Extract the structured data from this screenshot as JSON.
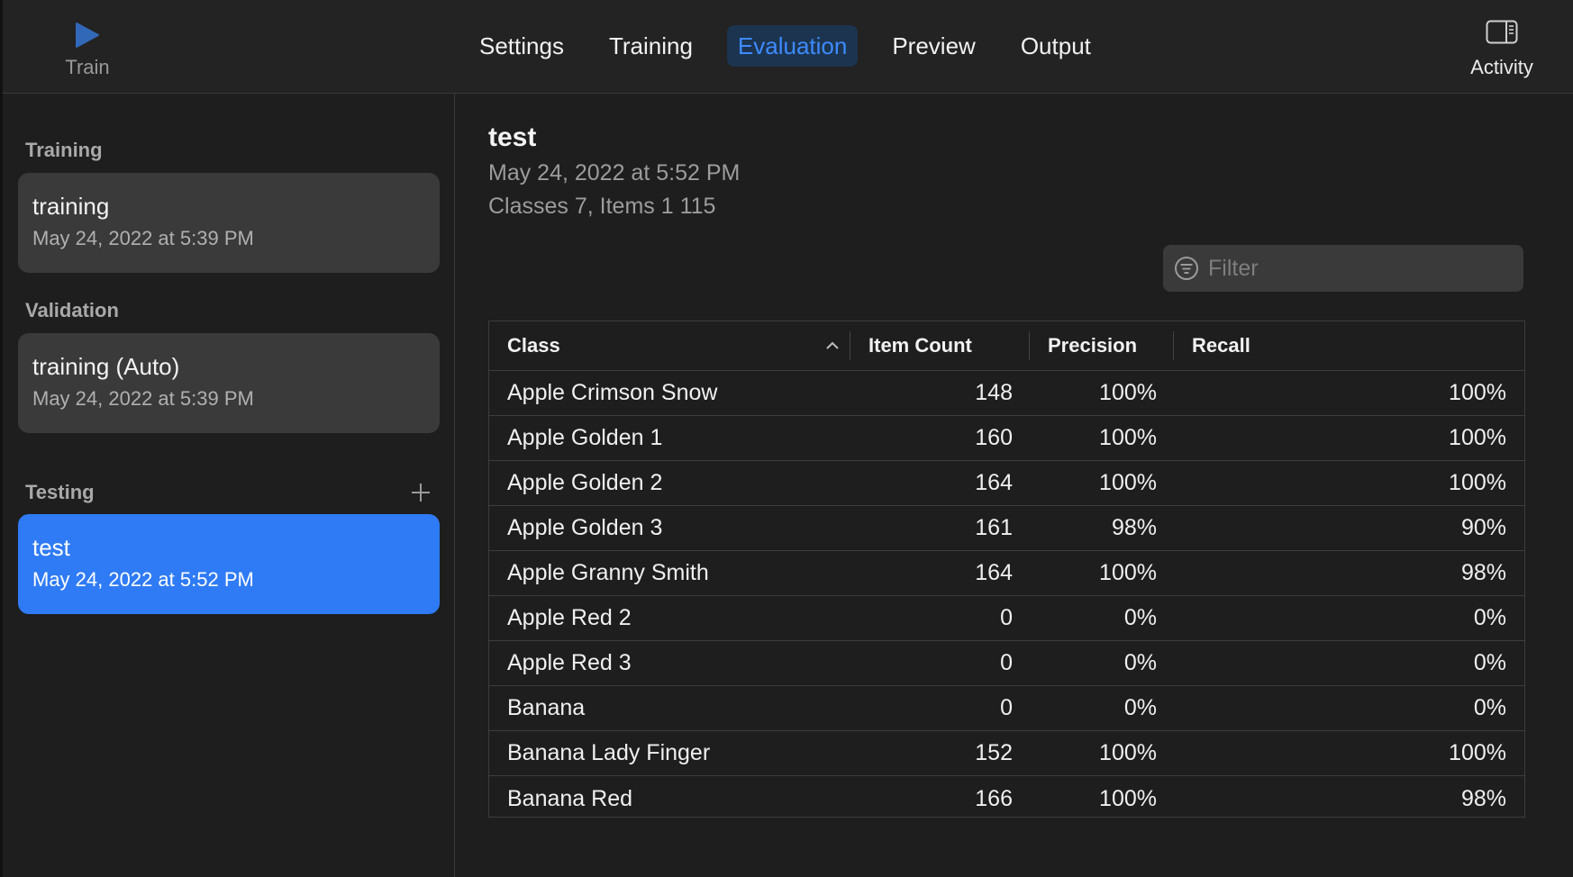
{
  "toolbar": {
    "train_label": "Train",
    "activity_label": "Activity",
    "tabs": [
      {
        "label": "Settings",
        "active": false
      },
      {
        "label": "Training",
        "active": false
      },
      {
        "label": "Evaluation",
        "active": true
      },
      {
        "label": "Preview",
        "active": false
      },
      {
        "label": "Output",
        "active": false
      }
    ]
  },
  "sidebar": {
    "training": {
      "header": "Training",
      "item": {
        "title": "training",
        "date": "May 24, 2022 at 5:39 PM"
      }
    },
    "validation": {
      "header": "Validation",
      "item": {
        "title": "training (Auto)",
        "date": "May 24, 2022 at 5:39 PM"
      }
    },
    "testing": {
      "header": "Testing",
      "item": {
        "title": "test",
        "date": "May 24, 2022 at 5:52 PM",
        "selected": true
      }
    }
  },
  "main": {
    "title": "test",
    "date": "May 24, 2022 at 5:52 PM",
    "summary": "Classes 7, Items 1 115",
    "filter": {
      "placeholder": "Filter",
      "value": ""
    },
    "table": {
      "columns": [
        "Class",
        "Item Count",
        "Precision",
        "Recall"
      ],
      "sort_column": "Class",
      "sort_direction": "ascending",
      "rows": [
        [
          "Apple Crimson Snow",
          "148",
          "100%",
          "100%"
        ],
        [
          "Apple Golden 1",
          "160",
          "100%",
          "100%"
        ],
        [
          "Apple Golden 2",
          "164",
          "100%",
          "100%"
        ],
        [
          "Apple Golden 3",
          "161",
          "98%",
          "90%"
        ],
        [
          "Apple Granny Smith",
          "164",
          "100%",
          "98%"
        ],
        [
          "Apple Red 2",
          "0",
          "0%",
          "0%"
        ],
        [
          "Apple Red 3",
          "0",
          "0%",
          "0%"
        ],
        [
          "Banana",
          "0",
          "0%",
          "0%"
        ],
        [
          "Banana Lady Finger",
          "152",
          "100%",
          "100%"
        ],
        [
          "Banana Red",
          "166",
          "100%",
          "98%"
        ]
      ]
    }
  },
  "colors": {
    "accent": "#2f7bf5",
    "active_tab_text": "#3d8bff",
    "play_icon": "#3268b8"
  },
  "icons": [
    "play-icon",
    "sidebar-toggle-icon",
    "plus-icon",
    "filter-icon",
    "chevron-up-icon"
  ]
}
